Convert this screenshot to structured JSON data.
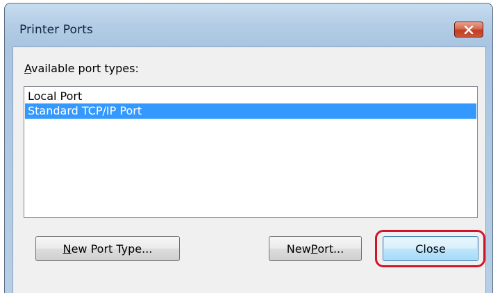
{
  "window": {
    "title": "Printer Ports"
  },
  "port_types": {
    "label_prefix": "",
    "label_accel": "A",
    "label_rest": "vailable port types:",
    "items": [
      {
        "label": "Local Port",
        "selected": false
      },
      {
        "label": "Standard TCP/IP Port",
        "selected": true
      }
    ]
  },
  "buttons": {
    "new_port_type": {
      "accel": "N",
      "rest": "ew Port Type..."
    },
    "new_port": {
      "pre": "New ",
      "accel": "P",
      "rest": "ort..."
    },
    "close": {
      "label": "Close"
    }
  },
  "colors": {
    "selection": "#3399ff",
    "highlight_ring": "#d0152a"
  }
}
